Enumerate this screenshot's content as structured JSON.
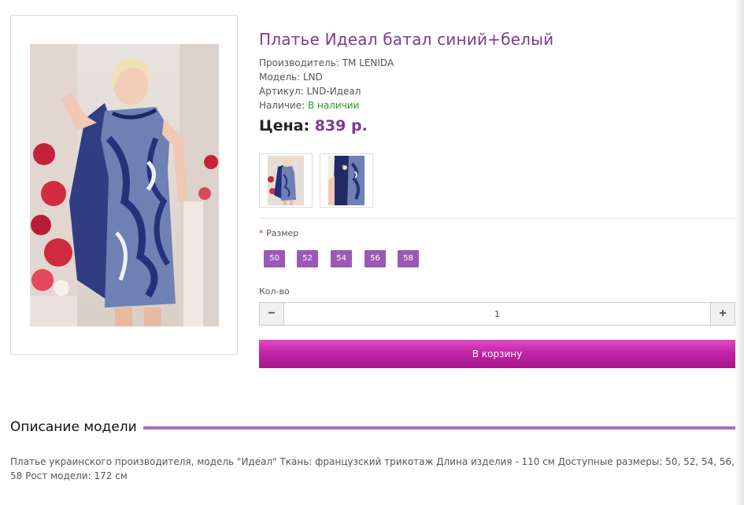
{
  "product": {
    "title": "Платье Идеал батал синий+белый",
    "manufacturer": "Производитель: ТМ LENIDA",
    "model": "Модель: LND",
    "article": "Артикул: LND-Идеал",
    "availability_label": "Наличие: ",
    "availability_value": "В наличии",
    "price_label": "Цена:",
    "price_value": "839 р.",
    "main_image": "product-photo-dress",
    "thumbnails": [
      "thumb-full-dress",
      "thumb-dress-detail"
    ]
  },
  "options": {
    "size_required_mark": "*",
    "size_label": "Размер",
    "sizes": [
      "50",
      "52",
      "54",
      "56",
      "58"
    ],
    "size_button_color": "#9b59b6"
  },
  "quantity": {
    "label": "Кол-во",
    "value": "1",
    "minus_icon": "minus-icon",
    "plus_icon": "plus-icon"
  },
  "cart": {
    "button_label": "В корзину",
    "color": "#c125a6"
  },
  "description": {
    "heading": "Описание модели",
    "text": "Платье украинского производителя, модель \"Идеал\" Ткань: французский трикотаж Длина изделия - 110 см Доступные размеры: 50, 52, 54, 56, 58 Рост модели: 172 см"
  },
  "colors": {
    "accent": "#7b3b93",
    "in_stock": "#2e9a2e"
  }
}
